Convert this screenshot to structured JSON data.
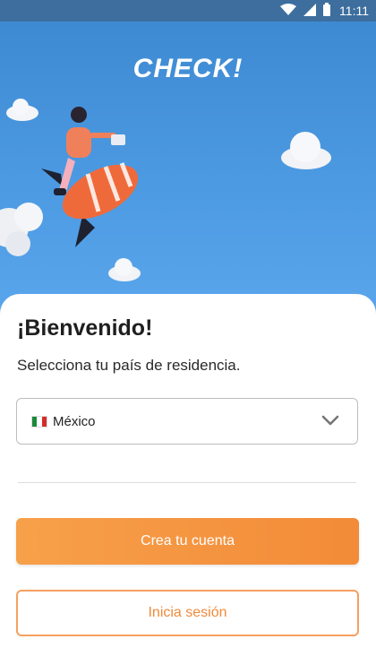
{
  "status_bar": {
    "time": "11:11",
    "icons": [
      "wifi-icon",
      "signal-icon",
      "battery-icon"
    ]
  },
  "hero": {
    "brand": "CHECK!",
    "illustration": "person-riding-rocket-with-laptop"
  },
  "welcome": {
    "title": "¡Bienvenido!",
    "subtitle": "Selecciona tu país de residencia."
  },
  "country_select": {
    "selected": "México",
    "flag_icon": "mexico-flag-icon",
    "chevron_icon": "chevron-down-icon"
  },
  "actions": {
    "create_account": "Crea tu cuenta",
    "login": "Inicia sesión"
  },
  "colors": {
    "status_bar": "#3d6e9e",
    "hero_sky": "#4c9ae2",
    "accent_orange": "#f38b38",
    "secondary_border": "#f5a061"
  }
}
